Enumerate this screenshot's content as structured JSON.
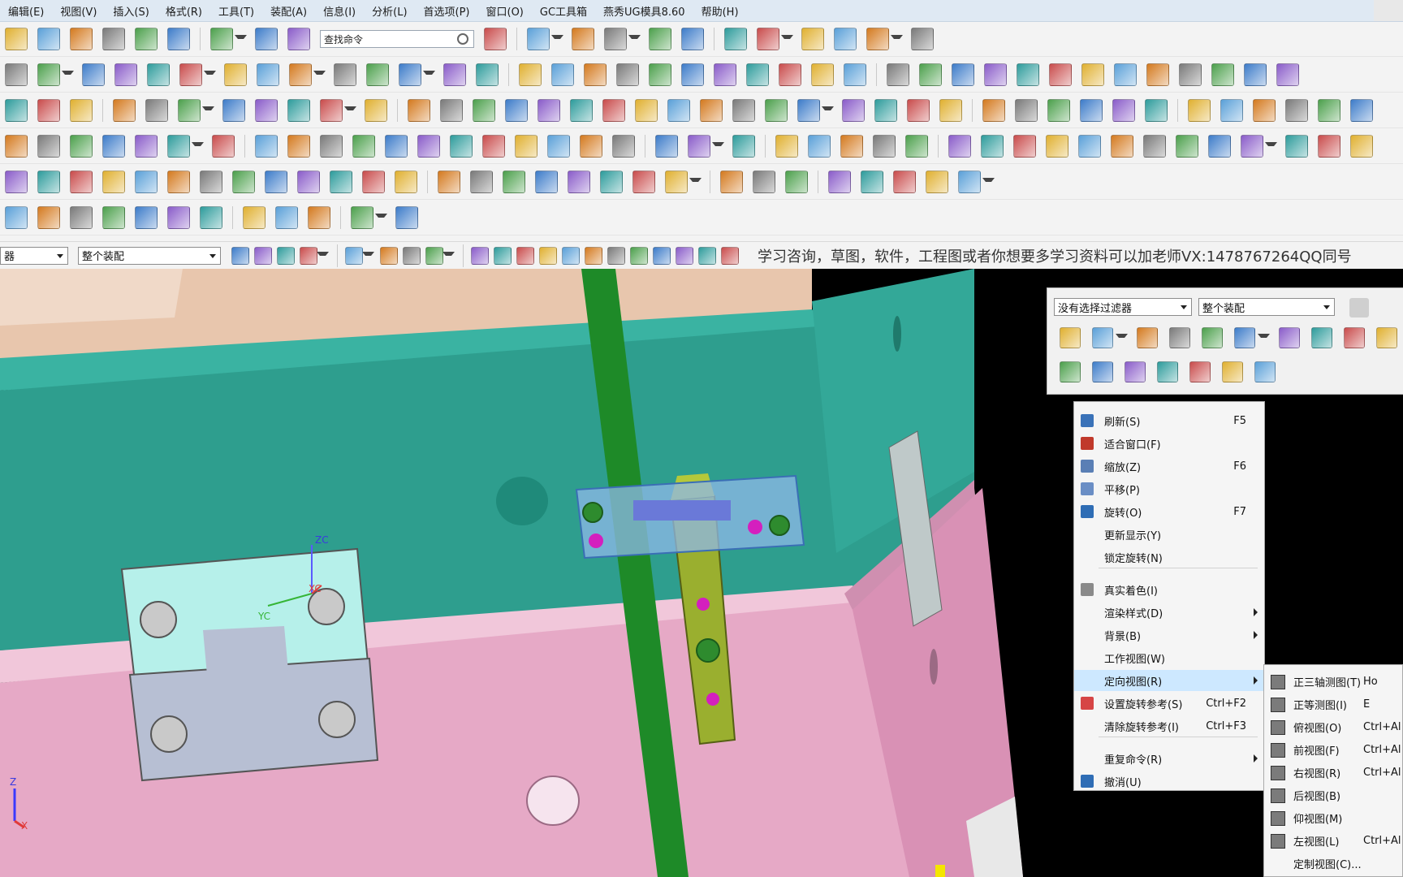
{
  "menubar": {
    "items": [
      "编辑(E)",
      "视图(V)",
      "插入(S)",
      "格式(R)",
      "工具(T)",
      "装配(A)",
      "信息(I)",
      "分析(L)",
      "首选项(P)",
      "窗口(O)",
      "GC工具箱",
      "燕秀UG模具8.60",
      "帮助(H)"
    ]
  },
  "toolbar": {
    "search_placeholder": "查找命令"
  },
  "filterbar": {
    "filter_value": "器",
    "scope_value": "整个装配",
    "notice": "学习咨询，草图，软件，工程图或者你想要多学习资料可以加老师VX:1478767264QQ同号"
  },
  "float_toolbar": {
    "filter_value": "没有选择过滤器",
    "scope_value": "整个装配"
  },
  "context_menu": {
    "items": [
      {
        "label": "刷新(S)",
        "shortcut": "F5",
        "icon": "refresh-icon",
        "color": "#3a72b8"
      },
      {
        "label": "适合窗口(F)",
        "shortcut": "",
        "icon": "fit-icon",
        "color": "#c0392b"
      },
      {
        "label": "缩放(Z)",
        "shortcut": "F6",
        "icon": "zoom-icon",
        "color": "#5a7fb5"
      },
      {
        "label": "平移(P)",
        "shortcut": "",
        "icon": "pan-icon",
        "color": "#6a8ec5"
      },
      {
        "label": "旋转(O)",
        "shortcut": "F7",
        "icon": "rotate-icon",
        "color": "#2f6db5"
      },
      {
        "label": "更新显示(Y)",
        "shortcut": "",
        "icon": "",
        "color": ""
      },
      {
        "label": "锁定旋转(N)",
        "shortcut": "",
        "icon": "",
        "color": ""
      },
      {
        "label": "真实着色(I)",
        "shortcut": "",
        "icon": "shading-icon",
        "color": "#8a8a8a"
      },
      {
        "label": "渲染样式(D)",
        "shortcut": "",
        "icon": "",
        "color": ""
      },
      {
        "label": "背景(B)",
        "shortcut": "",
        "icon": "",
        "color": ""
      },
      {
        "label": "工作视图(W)",
        "shortcut": "",
        "icon": "",
        "color": ""
      },
      {
        "label": "定向视图(R)",
        "shortcut": "",
        "icon": "",
        "color": ""
      },
      {
        "label": "设置旋转参考(S)",
        "shortcut": "Ctrl+F2",
        "icon": "rotate-ref-icon",
        "color": "#d64545"
      },
      {
        "label": "清除旋转参考(I)",
        "shortcut": "Ctrl+F3",
        "icon": "",
        "color": ""
      },
      {
        "label": "重复命令(R)",
        "shortcut": "",
        "icon": "",
        "color": ""
      },
      {
        "label": "撤消(U)",
        "shortcut": "",
        "icon": "undo-icon",
        "color": "#2f6db5"
      }
    ]
  },
  "submenu": {
    "items": [
      {
        "label": "正三轴测图(T)",
        "shortcut": "Ho"
      },
      {
        "label": "正等测图(I)",
        "shortcut": "E"
      },
      {
        "label": "俯视图(O)",
        "shortcut": "Ctrl+Al"
      },
      {
        "label": "前视图(F)",
        "shortcut": "Ctrl+Al"
      },
      {
        "label": "右视图(R)",
        "shortcut": "Ctrl+Al"
      },
      {
        "label": "后视图(B)",
        "shortcut": ""
      },
      {
        "label": "仰视图(M)",
        "shortcut": ""
      },
      {
        "label": "左视图(L)",
        "shortcut": "Ctrl+Al"
      },
      {
        "label": "定制视图(C)...",
        "shortcut": ""
      }
    ]
  },
  "viewport": {
    "axis_labels": {
      "zc": "ZC",
      "xc": "XC",
      "yc": "YC",
      "z": "Z",
      "x": "X"
    }
  }
}
